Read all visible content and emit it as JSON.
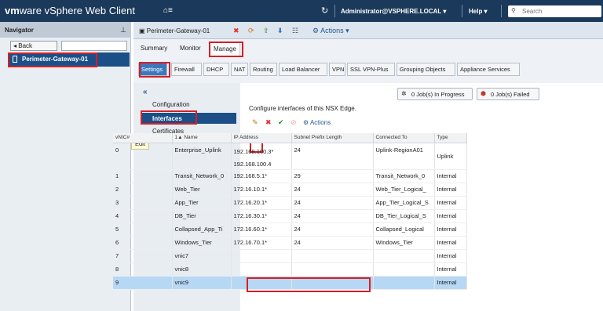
{
  "header": {
    "brand_vm": "vm",
    "brand_ware": "ware",
    "product": "vSphere Web Client",
    "home_icon": "home-icon",
    "user": "Administrator@VSPHERE.LOCAL ▾",
    "help": "Help ▾",
    "search_placeholder": "Search"
  },
  "navigator": {
    "title": "Navigator",
    "back_label": "◂ Back",
    "tree_item": "Perimeter-Gateway-01"
  },
  "object": {
    "title": "Perimeter-Gateway-01",
    "actions_label": "Actions ▾"
  },
  "tabs": [
    "Summary",
    "Monitor",
    "Manage"
  ],
  "subtabs": [
    "Settings",
    "Firewall",
    "DHCP",
    "NAT",
    "Routing",
    "Load Balancer",
    "VPN",
    "SSL VPN-Plus",
    "Grouping Objects",
    "Appliance Services"
  ],
  "left_nav": {
    "collapse": "«",
    "items": [
      "Configuration",
      "Interfaces",
      "Certificates"
    ]
  },
  "jobs": {
    "in_progress": "0 Job(s) In Progress",
    "failed": "0 Job(s) Failed"
  },
  "description": "Configure interfaces of this NSX Edge.",
  "toolbar": {
    "actions_label": "Actions",
    "tooltip": "Edit"
  },
  "table": {
    "columns": [
      "vNIC#",
      "1▲ Name",
      "IP Address",
      "Subnet Prefix Length",
      "Connected To",
      "Type"
    ],
    "rows": [
      {
        "vnic": "0",
        "name": "Enterprise_Uplink",
        "ip": "192.168.100.3*",
        "ip2": "192.168.100.4",
        "prefix": "24",
        "connected": "Uplink-RegionA01",
        "type": "Uplink"
      },
      {
        "vnic": "1",
        "name": "Transit_Network_0",
        "ip": "192.168.5.1*",
        "prefix": "29",
        "connected": "Transit_Network_0",
        "type": "Internal"
      },
      {
        "vnic": "2",
        "name": "Web_Tier",
        "ip": "172.16.10.1*",
        "prefix": "24",
        "connected": "Web_Tier_Logical_",
        "type": "Internal"
      },
      {
        "vnic": "3",
        "name": "App_Tier",
        "ip": "172.16.20.1*",
        "prefix": "24",
        "connected": "App_Tier_Logical_S",
        "type": "Internal"
      },
      {
        "vnic": "4",
        "name": "DB_Tier",
        "ip": "172.16.30.1*",
        "prefix": "24",
        "connected": "DB_Tier_Logical_S",
        "type": "Internal"
      },
      {
        "vnic": "5",
        "name": "Collapsed_App_Ti",
        "ip": "172.16.60.1*",
        "prefix": "24",
        "connected": "Collapsed_Logical",
        "type": "Internal"
      },
      {
        "vnic": "6",
        "name": "Windows_Tier",
        "ip": "172.16.70.1*",
        "prefix": "24",
        "connected": "Windows_Tier",
        "type": "Internal"
      },
      {
        "vnic": "7",
        "name": "vnic7",
        "ip": "",
        "prefix": "",
        "connected": "",
        "type": "Internal"
      },
      {
        "vnic": "8",
        "name": "vnic8",
        "ip": "",
        "prefix": "",
        "connected": "",
        "type": "Internal"
      },
      {
        "vnic": "9",
        "name": "vnic9",
        "ip": "",
        "prefix": "",
        "connected": "",
        "type": "Internal"
      }
    ]
  },
  "colors": {
    "header_bg": "#1b3a5b",
    "selected_blue": "#1c4f87",
    "highlight_red": "#d61f26",
    "row_selected": "#b7d8f4"
  }
}
